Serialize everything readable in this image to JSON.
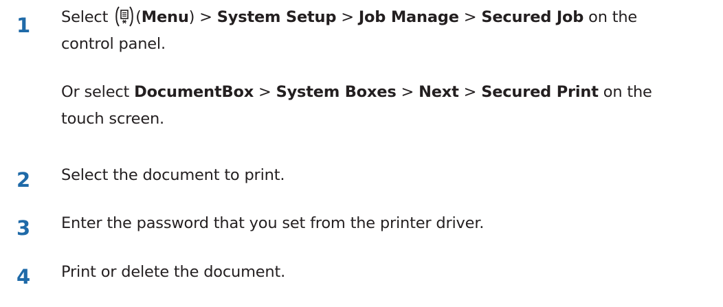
{
  "steps": [
    {
      "number": "1",
      "line1": {
        "t0": "Select ",
        "t1": "(",
        "menu": "Menu",
        "t2": ") > ",
        "system_setup": "System Setup",
        "sep1": " > ",
        "job_manage": "Job Manage",
        "sep2": " > ",
        "secured_job": "Secured Job",
        "t3": " on the"
      },
      "line2": "control panel.",
      "alt_line1": {
        "t0": "Or select ",
        "document_box": "DocumentBox",
        "sep1": " > ",
        "system_boxes": "System Boxes",
        "sep2": " > ",
        "next": "Next",
        "sep3": " > ",
        "secured_print": "Secured Print",
        "t1": " on the"
      },
      "alt_line2": "touch screen."
    },
    {
      "number": "2",
      "text": "Select the document to print."
    },
    {
      "number": "3",
      "text": "Enter the password that you set from the printer driver."
    },
    {
      "number": "4",
      "text": "Print or delete the document."
    }
  ],
  "icons": {
    "menu": "menu-icon"
  },
  "colors": {
    "step_number": "#1f6aa8",
    "text": "#231f20"
  }
}
